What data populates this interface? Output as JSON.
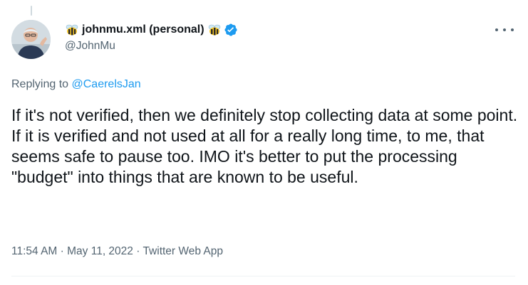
{
  "tweet": {
    "display_name": "johnmu.xml (personal)",
    "handle": "@JohnMu",
    "replying_prefix": "Replying to",
    "replying_to": "@CaerelsJan",
    "text": "If it's not verified, then we definitely stop collecting data at some point. If it is verified and not used at all for a really long time, to me, that seems safe to pause too. IMO it's better to put the processing \"budget\" into things that are known to be useful.",
    "time": "11:54 AM",
    "separator": "·",
    "date": "May 11, 2022",
    "source": "Twitter Web App"
  },
  "icons": {
    "left_emoji": "bee-icon",
    "right_emoji": "bee-icon",
    "badge": "verified-badge-icon",
    "menu": "more-options-icon"
  },
  "colors": {
    "text": "#0f1419",
    "secondary": "#536471",
    "link": "#1d9bf0",
    "verified": "#1d9bf0"
  }
}
